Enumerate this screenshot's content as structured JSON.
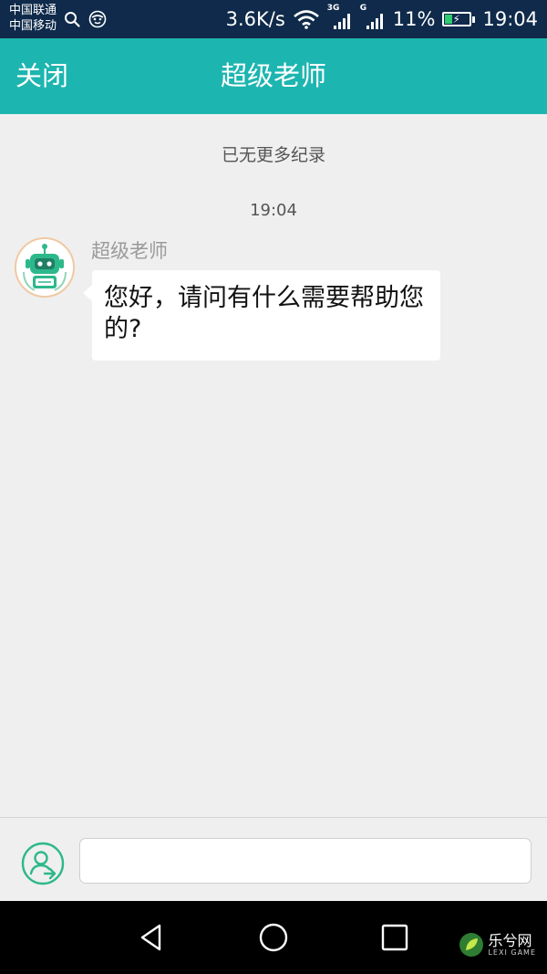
{
  "status_bar": {
    "carrier_1": "中国联通",
    "carrier_2": "中国移动",
    "net_speed": "3.6K/s",
    "signal_1_tag": "3G",
    "signal_2_tag": "G",
    "battery_percent": "11%",
    "time": "19:04"
  },
  "header": {
    "close_label": "关闭",
    "title": "超级老师"
  },
  "chat": {
    "no_more_records": "已无更多纪录",
    "timestamp": "19:04",
    "messages": [
      {
        "sender": "超级老师",
        "text": "您好，请问有什么需要帮助您的?"
      }
    ]
  },
  "input_bar": {
    "value": "",
    "placeholder": ""
  },
  "watermark": {
    "text": "乐兮网",
    "sub": "LEXI GAME"
  },
  "colors": {
    "header_bg": "#1db5b0",
    "status_bar_bg": "#0f2a4a",
    "chat_bg": "#efefef",
    "icon_accent": "#2db88b"
  }
}
